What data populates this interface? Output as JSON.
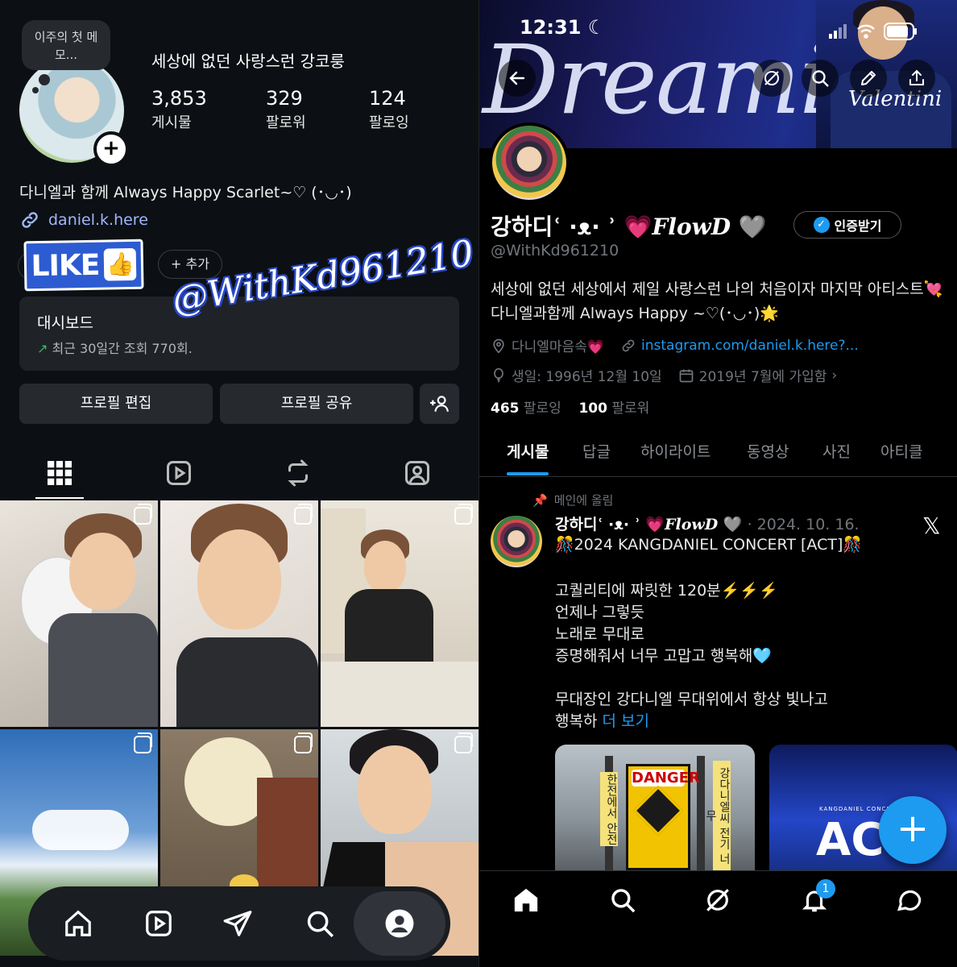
{
  "instagram": {
    "note": "이주의 첫 메모...",
    "profile_name": "세상에 없던 사랑스런 강코룽",
    "stats": [
      {
        "count": "3,853",
        "label": "게시물"
      },
      {
        "count": "329",
        "label": "팔로워"
      },
      {
        "count": "124",
        "label": "팔로잉"
      }
    ],
    "bio": "다니엘과 함께 Always Happy Scarlet~♡ (･◡･)",
    "link": "daniel.k.here",
    "sticker_text": "LIKE",
    "add_label": "+ 추가",
    "watermark": "@WithKd961210",
    "dashboard": {
      "title": "대시보드",
      "subtitle": "최근 30일간 조회 770회.",
      "arrow": "↗"
    },
    "buttons": {
      "edit": "프로필 편집",
      "share": "프로필 공유"
    },
    "tabs": [
      "grid-icon",
      "reels-icon",
      "repost-icon",
      "tagged-icon"
    ],
    "nav": [
      "home-icon",
      "reels-icon",
      "send-icon",
      "search-icon",
      "profile-icon"
    ]
  },
  "twitter": {
    "status": {
      "time": "12:31",
      "moon": "☾"
    },
    "banner_word": "Dreamin",
    "banner_jacket": "Valentini",
    "display_name": "강하디",
    "name_deco": "ʿ ·ᴥ· ʾ",
    "name_heart": "💗",
    "name_flow": "FlowD",
    "name_heart2": "🩶",
    "verify_label": "인증받기",
    "handle": "@WithKd961210",
    "bio": "세상에 없던 세상에서 제일 사랑스런 나의 처음이자 마지막 아티스트💘 다니엘과함께 Always Happy ~♡(･◡･)🌟",
    "location": "다니엘마음속💗",
    "website": "instagram.com/daniel.k.here?...",
    "birth": "생일: 1996년 12월 10일",
    "joined": "2019년 7월에 가입함",
    "following_count": "465",
    "following_label": "팔로잉",
    "followers_count": "100",
    "followers_label": "팔로워",
    "tabs": [
      "게시물",
      "답글",
      "하이라이트",
      "동영상",
      "사진",
      "아티클"
    ],
    "post": {
      "pinned_label": "메인에 올림",
      "author": "강하디",
      "date": "· 2024. 10. 16.",
      "lines": [
        "🎊2024 KANGDANIEL CONCERT [ACT]🎊",
        "고퀄리티에 짜릿한 120분⚡️⚡️⚡️",
        "언제나 그렇듯",
        "노래로 무대로",
        "증명해줘서 너무 고맙고 행복해🩵",
        "무대장인 강다니엘 무대위에서 항상 빛나고",
        "행복하"
      ],
      "more": "더 보기",
      "media1_text": "DANGER",
      "media1_banner_left": "한전에서 안전",
      "media1_banner_right": "강다니엘씨 전기 너무",
      "media2_text": "ACT",
      "media2_sub": "KANGDANIEL CONCERT"
    },
    "fab": "+",
    "notification_badge": "1"
  },
  "colors": {
    "twitter_blue": "#1d9bf0",
    "instagram_bg": "#0c1014",
    "link_blue": "#9fb7ff"
  }
}
